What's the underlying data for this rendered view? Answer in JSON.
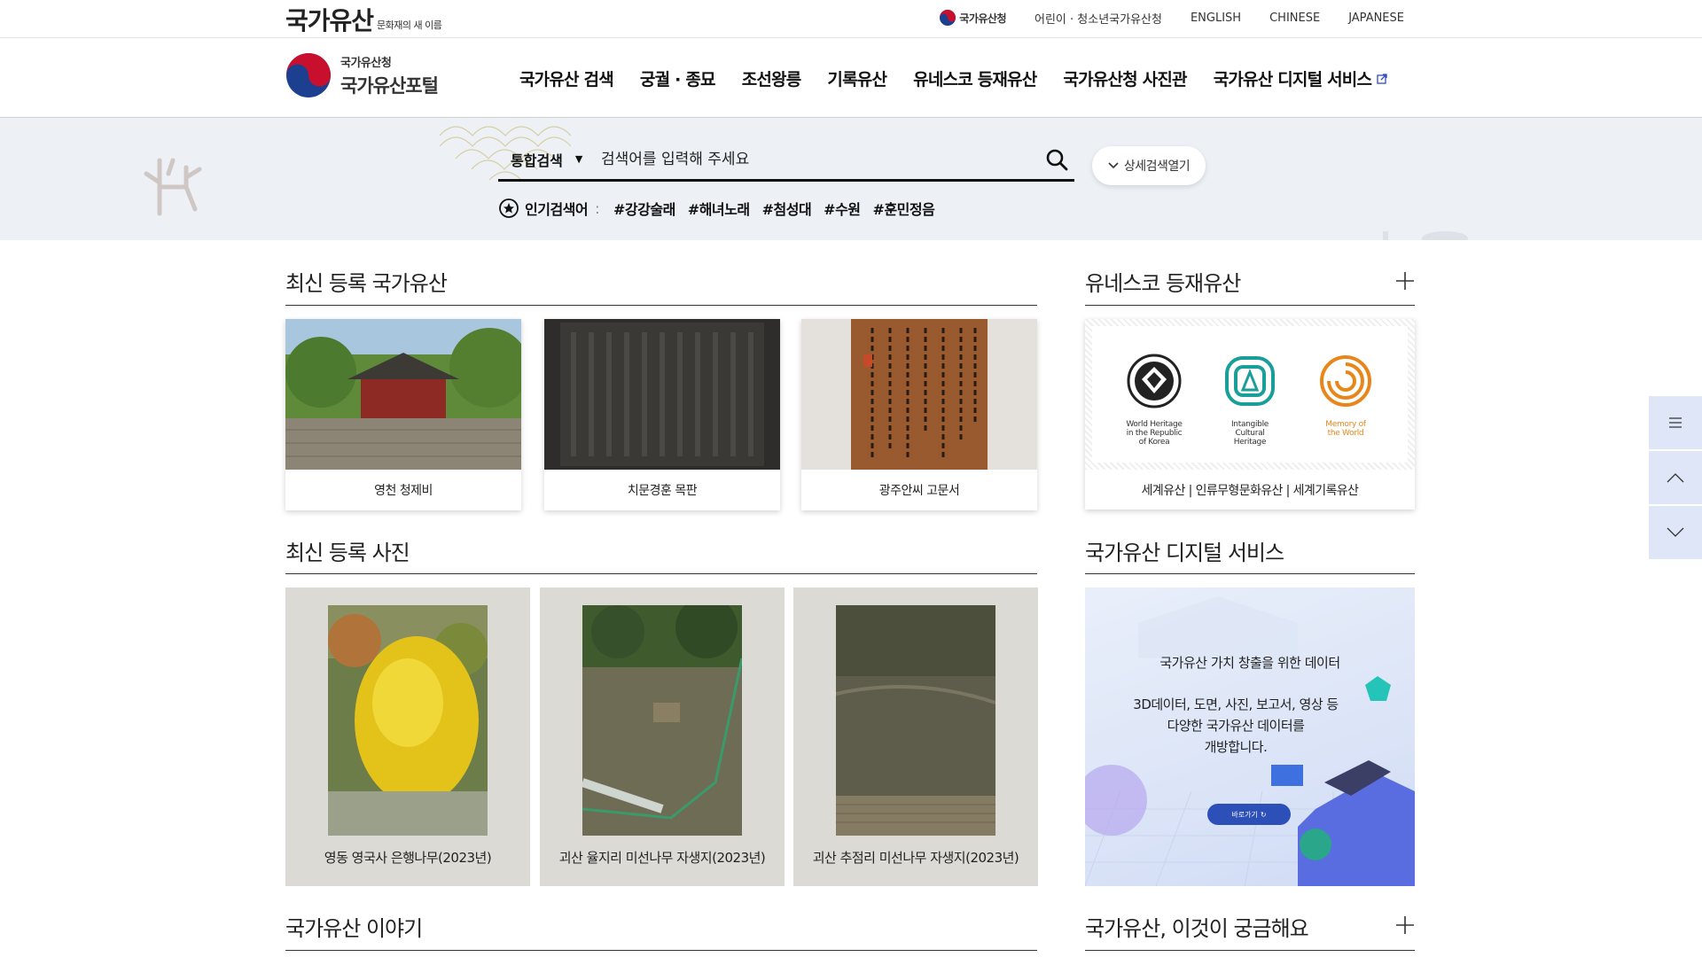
{
  "topbar": {
    "brand_main": "국가유산",
    "brand_sub": "문화재의 새 이름",
    "agency": "국가유산청",
    "links": [
      "어린이 · 청소년국가유산청",
      "ENGLISH",
      "CHINESE",
      "JAPANESE"
    ]
  },
  "header": {
    "logo_line1": "국가유산청",
    "logo_line2": "국가유산포털",
    "nav": [
      "국가유산 검색",
      "궁궐 · 종묘",
      "조선왕릉",
      "기록유산",
      "유네스코 등재유산",
      "국가유산청 사진관",
      "국가유산 디지털 서비스"
    ]
  },
  "search": {
    "scope": "통합검색",
    "placeholder": "검색어를 입력해 주세요",
    "advanced": "상세검색열기",
    "popular_label": "인기검색어",
    "popular_colon": ":",
    "popular": [
      "#강강술래",
      "#해녀노래",
      "#첨성대",
      "#수원",
      "#훈민정음"
    ]
  },
  "latest_heritage": {
    "title": "최신 등록 국가유산",
    "items": [
      "영천 청제비",
      "치문경훈 목판",
      "광주안씨 고문서"
    ]
  },
  "unesco": {
    "title": "유네스코 등재유산",
    "logos": [
      {
        "label": [
          "World Heritage",
          "in the Republic",
          "of Korea"
        ],
        "color": "#222222"
      },
      {
        "label": [
          "Intangible",
          "Cultural",
          "Heritage"
        ],
        "color": "#1a9e9a"
      },
      {
        "label": [
          "Memory of",
          "the World"
        ],
        "color": "#e8861a"
      }
    ],
    "caption": "세계유산 | 인류무형문화유산 | 세계기록유산"
  },
  "latest_photos": {
    "title": "최신 등록 사진",
    "items": [
      "영동 영국사 은행나무(2023년)",
      "괴산 율지리 미선나무 자생지(2023년)",
      "괴산 추점리 미선나무 자생지(2023년)"
    ]
  },
  "digital": {
    "title": "국가유산 디지털 서비스",
    "line1": "국가유산 가치 창출을 위한 데이터",
    "line2": "3D데이터, 도면, 사진, 보고서, 영상 등",
    "line3": "다양한 국가유산 데이터를",
    "line4": "개방합니다.",
    "button": "바로가기"
  },
  "story": {
    "title": "국가유산 이야기"
  },
  "faq": {
    "title": "국가유산, 이것이 궁금해요"
  },
  "colors": {
    "accent_blue": "#2d4fb8",
    "band_bg": "#edf0f5",
    "quick_bg": "#dfe6f7"
  }
}
